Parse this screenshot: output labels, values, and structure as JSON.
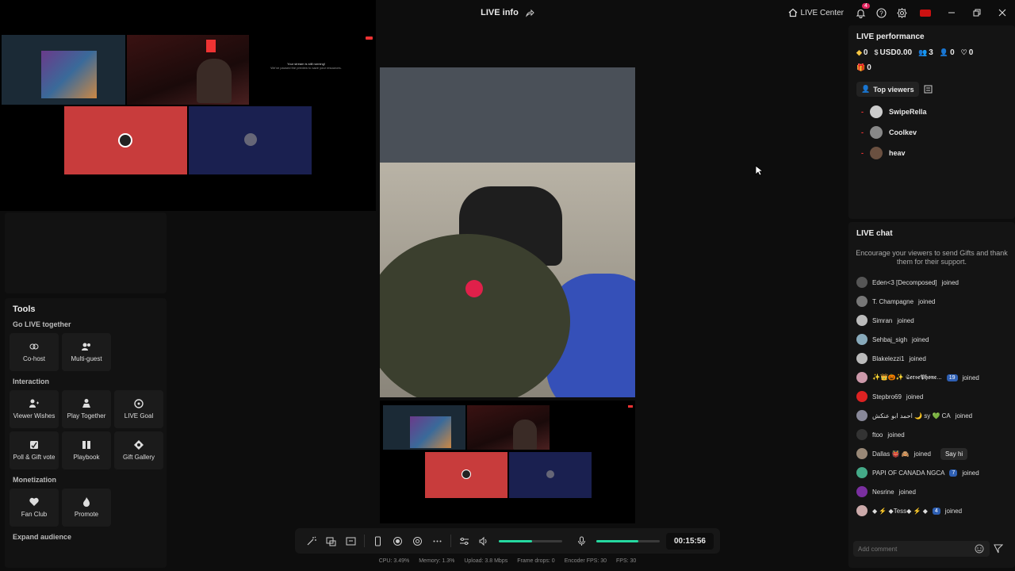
{
  "header": {
    "title": "LIVE info",
    "live_center": "LIVE Center",
    "notification_count": "4"
  },
  "tools": {
    "title": "Tools",
    "sections": [
      {
        "name": "Go LIVE together",
        "items": [
          "Co-host",
          "Multi-guest"
        ]
      },
      {
        "name": "Interaction",
        "items": [
          "Viewer Wishes",
          "Play Together",
          "LIVE Goal",
          "Poll & Gift vote",
          "Playbook",
          "Gift Gallery"
        ]
      },
      {
        "name": "Monetization",
        "items": [
          "Fan Club",
          "Promote"
        ]
      },
      {
        "name": "Expand audience",
        "items": []
      }
    ]
  },
  "controls": {
    "timer": "00:15:56",
    "volume_level": 0.52,
    "mic_level": 0.66
  },
  "stats": [
    "CPU: 3.49%",
    "Memory: 1.3%",
    "Upload: 3.8 Mbps",
    "Frame drops: 0",
    "Encoder FPS: 30",
    "FPS: 30"
  ],
  "performance": {
    "title": "LIVE performance",
    "diamonds": "0",
    "usd": "USD0.00",
    "viewers": "3",
    "followers": "0",
    "likes": "0",
    "gifts": "0",
    "top_viewers_tab": "Top viewers",
    "top_viewers": [
      {
        "rank": "-",
        "name": "SwipeRella"
      },
      {
        "rank": "-",
        "name": "Coolkev"
      },
      {
        "rank": "-",
        "name": "heav"
      }
    ]
  },
  "chat": {
    "title": "LIVE chat",
    "hint": "Encourage your viewers to send Gifts and thank them for their support.",
    "joined_word": "joined",
    "say_hi": "Say hi",
    "placeholder": "Add comment",
    "messages": [
      {
        "name": "Eden<3 [Decomposed]",
        "badge": "",
        "color": "#555"
      },
      {
        "name": "T. Champagne",
        "badge": "",
        "color": "#777"
      },
      {
        "name": "Simran",
        "badge": "",
        "color": "#bbb"
      },
      {
        "name": "Sehbaj_sigh",
        "badge": "",
        "color": "#8ab"
      },
      {
        "name": "Blakelezzi1",
        "badge": "",
        "color": "#bbb"
      },
      {
        "name": "✨👑🎃✨ 𝕾𝖊𝖗𝖘𝖊𝕻𝖍𝖔𝖓𝖊...",
        "badge": "19",
        "color": "#c9a"
      },
      {
        "name": "Stepbro69",
        "badge": "",
        "color": "#d22"
      },
      {
        "name": "احمد ابو عنكش 🌙 sy 💚 CA",
        "badge": "",
        "color": "#889"
      },
      {
        "name": "ftoo",
        "badge": "",
        "color": "#333"
      },
      {
        "name": "Dallas 👹 🙈",
        "badge": "",
        "color": "#987"
      },
      {
        "name": "PAPI OF CANADA NGCA",
        "badge": "7",
        "color": "#4a8"
      },
      {
        "name": "Nesrine",
        "badge": "",
        "color": "#7a2fa0"
      },
      {
        "name": "◆ ⚡ ◆Tess◆ ⚡ ◆",
        "badge": "4",
        "color": "#caa"
      }
    ]
  },
  "preview_text": {
    "line1": "Your stream is still running!",
    "line2": "We've paused the preview to save your resources."
  }
}
